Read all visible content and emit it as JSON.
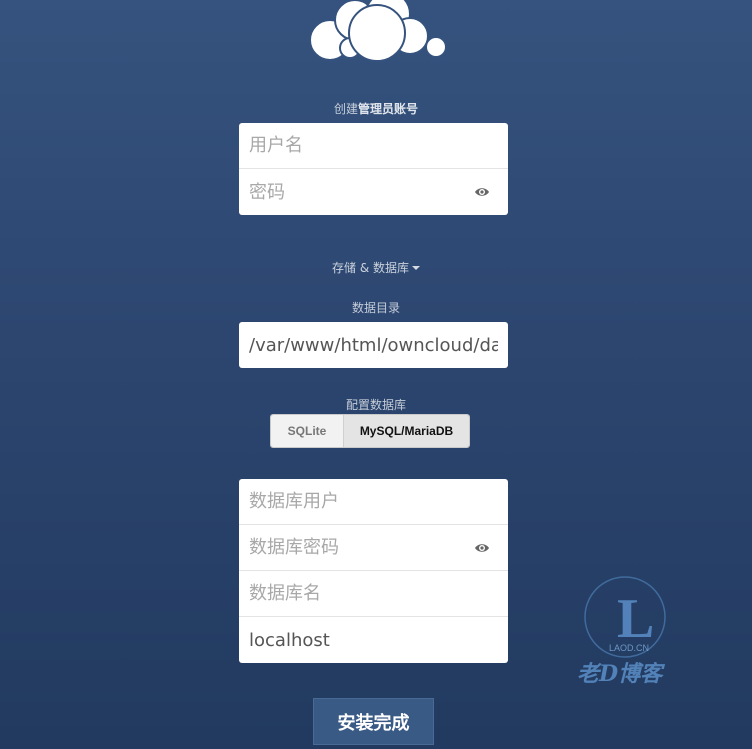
{
  "admin": {
    "label_prefix": "创建",
    "label_bold": "管理员账号",
    "username_placeholder": "用户名",
    "password_placeholder": "密码"
  },
  "storage": {
    "toggle_label": "存储 & 数据库",
    "data_dir_label": "数据目录",
    "data_dir_value": "/var/www/html/owncloud/data"
  },
  "database": {
    "config_label": "配置数据库",
    "options": [
      "SQLite",
      "MySQL/MariaDB"
    ],
    "selected": "MySQL/MariaDB",
    "user_placeholder": "数据库用户",
    "password_placeholder": "数据库密码",
    "name_placeholder": "数据库名",
    "host_value": "localhost"
  },
  "install_button": "安装完成",
  "watermark": {
    "text": "老D博客",
    "site": "LAOD.CN"
  },
  "colors": {
    "background_top": "#35537e",
    "background_bottom": "#223a5f",
    "button": "#3a5a86"
  }
}
